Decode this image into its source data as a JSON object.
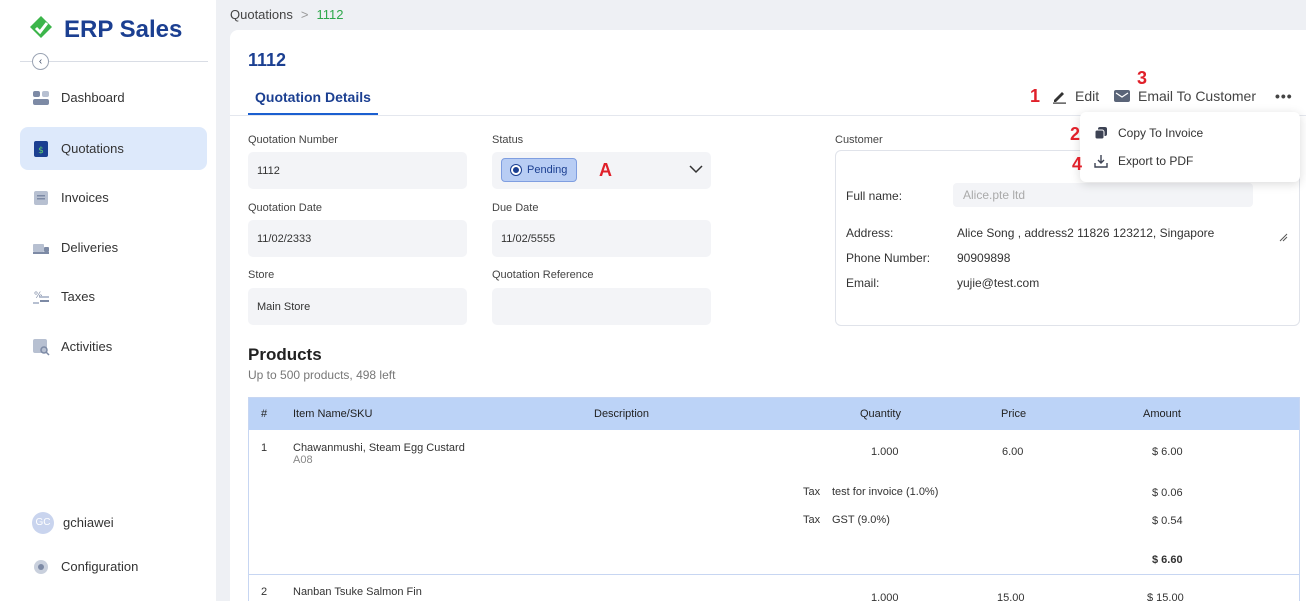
{
  "sidebar": {
    "brand": "ERP Sales",
    "items": [
      {
        "label": "Dashboard"
      },
      {
        "label": "Quotations"
      },
      {
        "label": "Invoices"
      },
      {
        "label": "Deliveries"
      },
      {
        "label": "Taxes"
      },
      {
        "label": "Activities"
      }
    ],
    "user": {
      "initials": "GC",
      "name": "gchiawei"
    },
    "config_label": "Configuration"
  },
  "breadcrumb": {
    "root": "Quotations",
    "separator": ">",
    "current": "1112"
  },
  "page": {
    "title": "1112",
    "tab": "Quotation Details"
  },
  "actions": {
    "edit": "Edit",
    "email": "Email To Customer",
    "more": "•••"
  },
  "annotations": {
    "a1": "1",
    "a2": "2",
    "a3": "3",
    "a4": "4",
    "aA": "A"
  },
  "dropdown": {
    "copy": "Copy To Invoice",
    "export": "Export to PDF"
  },
  "form": {
    "quotation_number_label": "Quotation Number",
    "quotation_number": "1112",
    "status_label": "Status",
    "status": "Pending",
    "quotation_date_label": "Quotation Date",
    "quotation_date": "11/02/2333",
    "due_date_label": "Due Date",
    "due_date": "11/02/5555",
    "store_label": "Store",
    "store": "Main Store",
    "reference_label": "Quotation Reference",
    "reference": ""
  },
  "customer": {
    "label": "Customer",
    "full_name_label": "Full name:",
    "full_name": "Alice.pte ltd",
    "address_label": "Address:",
    "address": "Alice Song , address2 11826 123212, Singapore",
    "phone_label": "Phone Number:",
    "phone": "90909898",
    "email_label": "Email:",
    "email": "yujie@test.com"
  },
  "products": {
    "title": "Products",
    "subtitle": "Up to 500 products, 498 left",
    "columns": {
      "num": "#",
      "item": "Item Name/SKU",
      "desc": "Description",
      "qty": "Quantity",
      "price": "Price",
      "amount": "Amount"
    },
    "rows": [
      {
        "num": "1",
        "name": "Chawanmushi, Steam Egg Custard",
        "sku": "A08",
        "qty": "1.000",
        "price": "6.00",
        "amount": "$ 6.00",
        "taxes": [
          {
            "label": "Tax",
            "name": "test for invoice (1.0%)",
            "amount": "$ 0.06"
          },
          {
            "label": "Tax",
            "name": "GST (9.0%)",
            "amount": "$ 0.54"
          }
        ],
        "total": "$ 6.60"
      },
      {
        "num": "2",
        "name": "Nanban Tsuke Salmon Fin",
        "qty": "1.000",
        "price": "15.00",
        "amount": "$ 15.00"
      }
    ]
  },
  "colors": {
    "brand": "#1b3f91",
    "accent_green": "#2ea84b",
    "annotation_red": "#e0202a",
    "table_header": "#bcd3f7"
  }
}
